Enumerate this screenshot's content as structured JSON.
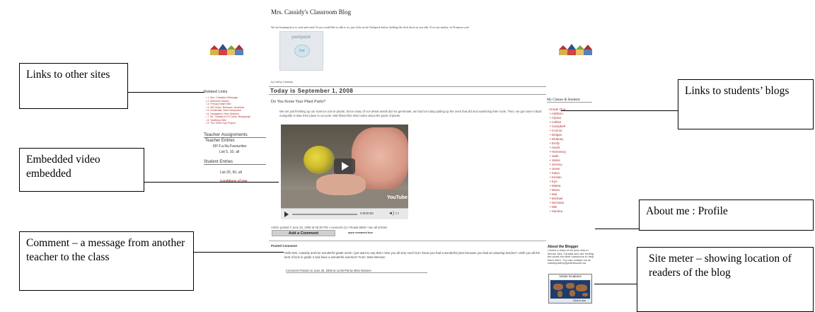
{
  "callouts": {
    "links_other_sites": "Links to other sites",
    "embedded_video": "Embedded video embedded",
    "comment": "Comment – a message from another teacher to the class",
    "links_students_blogs": "Links to students’ blogs",
    "about_me": "About me : Profile",
    "site_meter": "Site meter – showing location of readers of the blog"
  },
  "blog": {
    "title": "Mrs. Cassidy's Classroom Blog",
    "intro": "We are learning how to read and write! If you would like to talk to us, just click on the Yackpack below, holding the click down as you talk. If we are nearby, we'll answer you!",
    "yackpack_label": "yackpack",
    "yackpack_bubble": "live",
    "byline": "by Kathy Cassidy",
    "date_header": "Today is September 1, 2008",
    "post_title": "Do You Know Your Plant Parts?",
    "post_body": "We are just finishing up our science unit on plants. Since many of our wheat seeds did not germinate, we had fun today pulling up the ones that did and examining their roots. Then, we got some robust marigolds to take their place in our pots. Mat filmed this short video about the parts of plants.",
    "video": {
      "time": "0:00/0:00",
      "logo": "YouTube",
      "controls_icons": "◄) ▭"
    },
    "article_meta": "Article posted # June 25, 2008 at 05:30 PM • comment (1) • Reads 5860 • see all articles",
    "add_comment": "Add a Comment",
    "open_comment_box": "open comment box",
    "posted_comment_header": "Posted Comment",
    "comment_text": "Hello Mrs. Cassidy and her wonderful grade ones! I just want to say that I miss you all very much but I know you had a wonderful year because you had an amazing teacher! I wish you all the best of luck in grade 2 and have a wonderful summer!! From: Miss Wessen",
    "comment_footer": "Comment Posted on June 26, 2008 at 11:06 PM by Miss Wessen"
  },
  "left_sidebar": {
    "related_header": "Related Links",
    "related_links": [
      "• 1. Mrs. Cassidy's Message",
      "• 2. Ashwinar Andrus",
      "• 3. Primary Math Wiki",
      "• 4. 2M Gems, Brisbane, Australia",
      "• 5. Kindertalk, New Hampshire",
      "• 6. Navigators, New Zealand",
      "• 7. Mr. Cassidy's K/2 Class, Bergvaugh",
      "• 8. Tactilvina Wiki",
      "• 9. The 100th Day Project"
    ],
    "teacher_assignments": "Teacher Assignments",
    "teacher_entries": "Teacher Entries",
    "teacher_line1": "60! F.a.Nu Favourites",
    "teacher_line2": "List 5, 10, all",
    "student_entries": "Student Entries",
    "student_line": "List 25, 50, all",
    "conditions": "Conditions of Use"
  },
  "right_sidebar": {
    "classes_header": "My Classes & Students",
    "grade": "-Grade One",
    "students": [
      "Addison",
      "Alyssa",
      "Ashlee",
      "Campbell",
      "Connor",
      "Delgan",
      "Delaney",
      "Emily",
      "Hazel",
      "Hennessy",
      "Jade",
      "Jamie",
      "Jeremy",
      "Jesse",
      "Kalyn",
      "Kristan",
      "Kye",
      "Matea",
      "Mesa",
      "Mia",
      "Michael",
      "Nicholas",
      "Niki",
      "Samlea"
    ],
    "about_header": "About the Blogger",
    "about_text": "I teach a class of six year olds in Moose Jaw, Canada who are inviting the world into their classroom to help them learn. You can contact me at cassidy.kathy@prairiesouth.ca",
    "visitor_label": "Visitor locations",
    "click_to_see": "Click to see"
  },
  "colors": {
    "link_red": "#aa3333",
    "callout_border": "#000000"
  }
}
